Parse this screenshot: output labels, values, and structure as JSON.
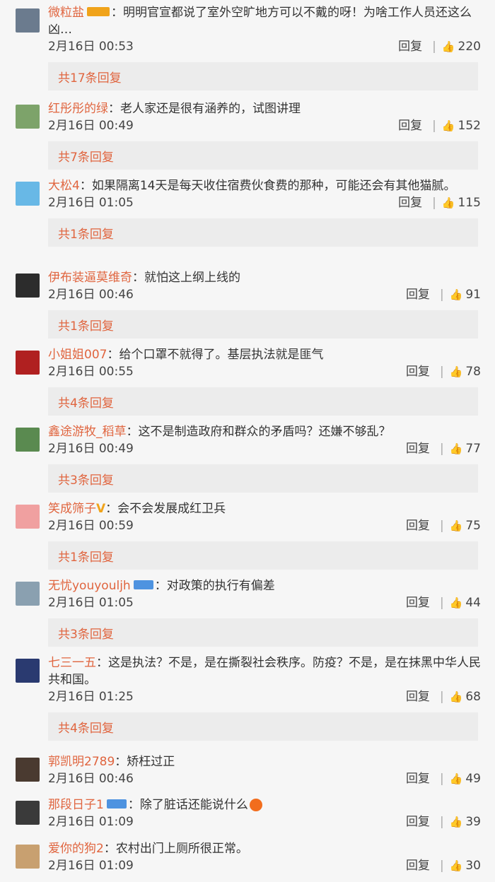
{
  "comments": [
    {
      "user": "微粒盐",
      "badge": "",
      "text": "：明明官宣都说了室外空旷地方可以不戴的呀！为啥工作人员还这么凶…",
      "time": "2月16日 00:53",
      "reply": "回复",
      "likes": "220",
      "replies": "共17条回复",
      "avatar": "#6b7b8e"
    },
    {
      "user": "红彤彤的绿",
      "badge": "",
      "text": "：老人家还是很有涵养的，试图讲理",
      "time": "2月16日 00:49",
      "reply": "回复",
      "likes": "152",
      "replies": "共7条回复",
      "avatar": "#7da36a"
    },
    {
      "user": "大松4",
      "badge": "",
      "text": "：如果隔离14天是每天收住宿费伙食费的那种，可能还会有其他猫腻。",
      "time": "2月16日 01:05",
      "reply": "回复",
      "likes": "115",
      "replies": "共1条回复",
      "avatar": "#68b8e6"
    },
    {
      "user": "伊布装逼莫维奇",
      "badge": "",
      "text": "：就怕这上纲上线的",
      "time": "2月16日 00:46",
      "reply": "回复",
      "likes": "91",
      "replies": "共1条回复",
      "avatar": "#2c2c2c"
    },
    {
      "user": "小姐姐007",
      "badge": "",
      "text": "：给个口罩不就得了。基层执法就是匪气",
      "time": "2月16日 00:55",
      "reply": "回复",
      "likes": "78",
      "replies": "共4条回复",
      "avatar": "#b02020"
    },
    {
      "user": "鑫途游牧_稻草",
      "badge": "",
      "text": "：这不是制造政府和群众的矛盾吗？还嫌不够乱？",
      "time": "2月16日 00:49",
      "reply": "回复",
      "likes": "77",
      "replies": "共3条回复",
      "avatar": "#5a8a50"
    },
    {
      "user": "笑成筛子",
      "badge": "V",
      "text": "：会不会发展成红卫兵",
      "time": "2月16日 00:59",
      "reply": "回复",
      "likes": "75",
      "replies": "共1条回复",
      "avatar": "#f0a0a0"
    },
    {
      "user": "无忧youyouljh",
      "badge": "blue",
      "text": "：对政策的执行有偏差",
      "time": "2月16日 01:05",
      "reply": "回复",
      "likes": "44",
      "replies": "共3条回复",
      "avatar": "#8aa0b0"
    },
    {
      "user": "七三一五",
      "badge": "",
      "text": "：这是执法？不是，是在撕裂社会秩序。防疫？不是，是在抹黑中华人民共和国。",
      "time": "2月16日 01:25",
      "reply": "回复",
      "likes": "68",
      "replies": "共4条回复",
      "avatar": "#2a3a70"
    },
    {
      "user": "郭凯明2789",
      "badge": "",
      "text": "：矫枉过正",
      "time": "2月16日 00:46",
      "reply": "回复",
      "likes": "49",
      "replies": "",
      "avatar": "#4a3a30"
    },
    {
      "user": "那段日子1",
      "badge": "blue",
      "text": "：除了脏话还能说什么",
      "time": "2月16日 01:09",
      "reply": "回复",
      "likes": "39",
      "replies": "",
      "avatar": "#3a3a3a",
      "emoji": true
    },
    {
      "user": "爱你的狗2",
      "badge": "",
      "text": "：农村出门上厕所很正常。",
      "time": "2月16日 01:09",
      "reply": "回复",
      "likes": "30",
      "replies": "",
      "avatar": "#c8a070"
    }
  ]
}
